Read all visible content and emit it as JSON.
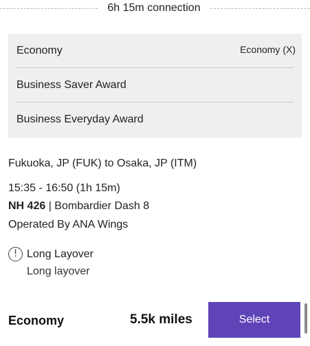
{
  "connection": {
    "label": "6h 15m connection"
  },
  "fares": [
    {
      "name": "Economy",
      "badge": "Economy (X)"
    },
    {
      "name": "Business Saver Award"
    },
    {
      "name": "Business Everyday Award"
    }
  ],
  "segment": {
    "route": "Fukuoka, JP (FUK) to Osaka, JP (ITM)",
    "times": "15:35 - 16:50 (1h 15m)",
    "flight_number": "NH 426",
    "aircraft": " | Bombardier Dash 8",
    "operated_by": "Operated By ANA Wings"
  },
  "layover": {
    "icon": "alert-circle-icon",
    "title": "Long Layover",
    "description": "Long layover"
  },
  "footer": {
    "cabin": "Economy",
    "miles": "5.5k miles",
    "select_label": "Select"
  },
  "colors": {
    "accent": "#5f44b8",
    "panel": "#efefef"
  }
}
